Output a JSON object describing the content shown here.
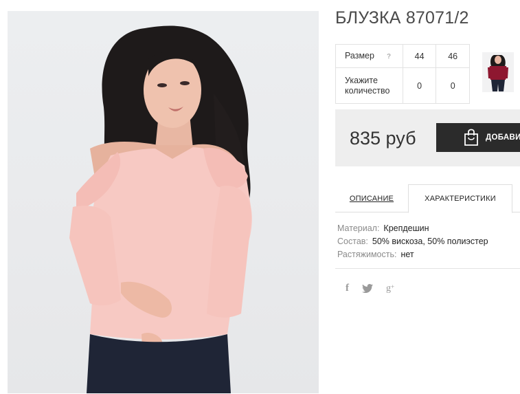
{
  "product": {
    "title": "БЛУЗКА 87071/2",
    "image_icon": "product-photo-blouse",
    "thumbnail_icon": "product-thumbnail-red-blouse"
  },
  "size_table": {
    "size_label": "Размер",
    "help_icon_text": "?",
    "sizes": [
      "44",
      "46"
    ],
    "qty_label": "Укажите количество",
    "qty_values": [
      "0",
      "0"
    ]
  },
  "price": {
    "value": "835 руб",
    "cart_button_label": "ДОБАВИТЬ",
    "cart_icon": "shopping-bag-icon"
  },
  "tabs": [
    {
      "label": "ОПИСАНИЕ",
      "active": false
    },
    {
      "label": "ХАРАКТЕРИСТИКИ",
      "active": true
    }
  ],
  "specs": [
    {
      "key": "Материал:",
      "value": "Крепдешин"
    },
    {
      "key": "Состав:",
      "value": "50% вискоза, 50% полиэстер"
    },
    {
      "key": "Растяжимость:",
      "value": "нет"
    }
  ],
  "social": {
    "facebook": "f",
    "twitter_icon": "twitter-icon",
    "googleplus": "g",
    "googleplus_sup": "+"
  },
  "colors": {
    "blouse": "#f7c9c3",
    "button_bg": "#2b2b2b",
    "price_bg": "#eeeeee"
  }
}
